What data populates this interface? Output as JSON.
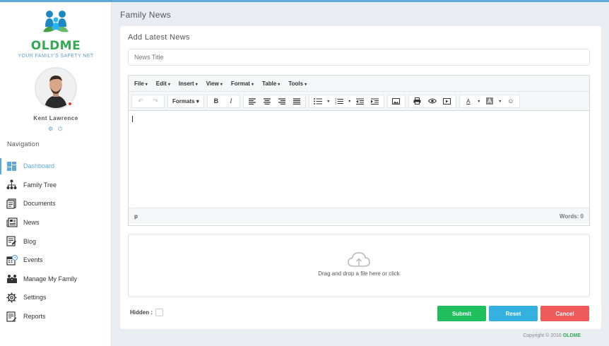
{
  "brand": {
    "name": "OLDME",
    "tagline": "YOUR FAMILY'S SAFETY NET"
  },
  "user": {
    "name": "Kent Lawrence",
    "settings_icon": "gear-icon",
    "logout_icon": "power-icon"
  },
  "sidebar": {
    "title": "Navigation",
    "items": [
      {
        "label": "Dashboard",
        "icon": "dashboard-icon",
        "active": true
      },
      {
        "label": "Family Tree",
        "icon": "family-tree-icon"
      },
      {
        "label": "Documents",
        "icon": "documents-icon"
      },
      {
        "label": "News",
        "icon": "news-icon"
      },
      {
        "label": "Blog",
        "icon": "blog-icon"
      },
      {
        "label": "Events",
        "icon": "events-icon"
      },
      {
        "label": "Manage My Family",
        "icon": "family-icon"
      },
      {
        "label": "Settings",
        "icon": "settings-icon"
      },
      {
        "label": "Reports",
        "icon": "reports-icon"
      }
    ]
  },
  "page": {
    "title": "Family News"
  },
  "form": {
    "heading": "Add Latest News",
    "title_placeholder": "News Title",
    "editor": {
      "menus": [
        "File",
        "Edit",
        "Insert",
        "View",
        "Format",
        "Table",
        "Tools"
      ],
      "formats_label": "Formats",
      "bold_label": "B",
      "italic_label": "I",
      "text_color_label": "A",
      "path_label": "p",
      "word_count": "Words: 0"
    },
    "dropzone_text": "Drag and drop a file here or click",
    "hidden_label": "Hidden :",
    "submit_label": "Submit",
    "reset_label": "Reset",
    "cancel_label": "Cancel"
  },
  "footer": {
    "text": "Copyright © 2016",
    "brand": "OLDME"
  },
  "colors": {
    "accent": "#5ea8da",
    "brand_green": "#34a853",
    "submit": "#1fbf5e",
    "reset": "#33b2e0",
    "cancel": "#ef5a5a"
  }
}
